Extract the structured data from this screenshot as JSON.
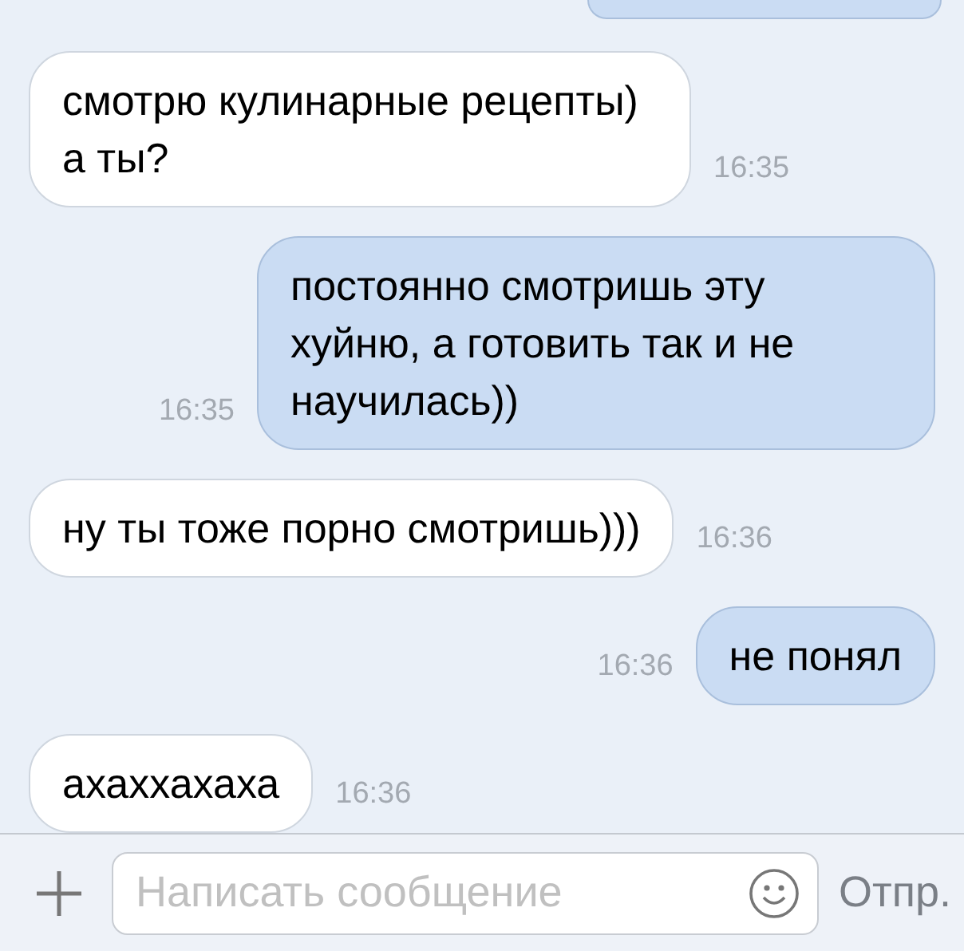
{
  "messages": [
    {
      "kind": "in",
      "text": "смотрю кулинарные рецепты) а ты?",
      "time": "16:35"
    },
    {
      "kind": "out",
      "text": "постоянно смотришь эту хуйню, а готовить так и не научилась))",
      "time": "16:35"
    },
    {
      "kind": "in",
      "text": "ну ты тоже порно смотришь)))",
      "time": "16:36"
    },
    {
      "kind": "out",
      "text": "не понял",
      "time": "16:36"
    },
    {
      "kind": "in",
      "text": "ахаххахаха",
      "time": "16:36"
    }
  ],
  "composer": {
    "placeholder": "Написать сообщение",
    "send": "Отпр."
  }
}
